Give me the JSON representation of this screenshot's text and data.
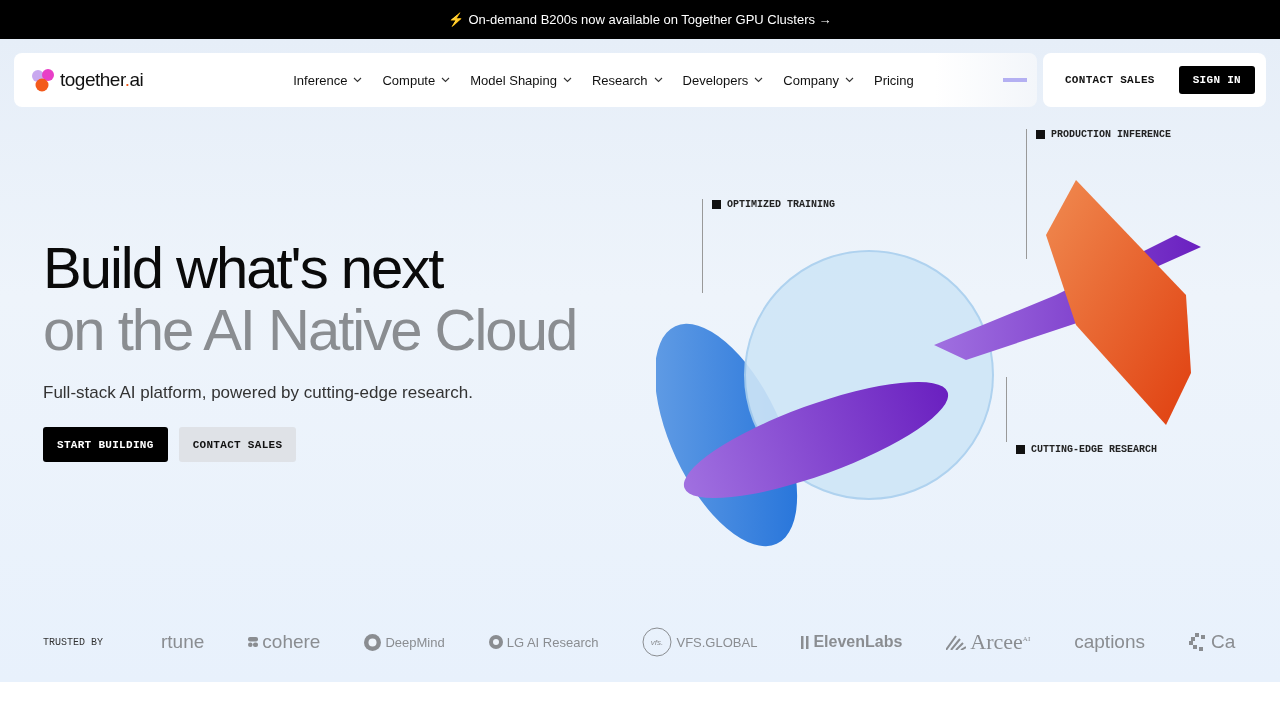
{
  "announcement": {
    "icon": "⚡",
    "text": "On-demand B200s now available on Together GPU Clusters →"
  },
  "nav": {
    "logo": {
      "name": "together",
      "accent": ".",
      "suffix": "ai"
    },
    "items": [
      {
        "label": "Inference",
        "dropdown": true
      },
      {
        "label": "Compute",
        "dropdown": true
      },
      {
        "label": "Model Shaping",
        "dropdown": true
      },
      {
        "label": "Research",
        "dropdown": true
      },
      {
        "label": "Developers",
        "dropdown": true
      },
      {
        "label": "Company",
        "dropdown": true
      },
      {
        "label": "Pricing",
        "dropdown": false
      }
    ],
    "contact": "CONTACT SALES",
    "sign_in": "SIGN IN"
  },
  "hero": {
    "title": "Build what's next",
    "title_2": "on the AI Native Cloud",
    "subtitle": "Full-stack AI platform, powered by cutting-edge research.",
    "primary": "START BUILDING",
    "secondary": "CONTACT SALES",
    "callouts": [
      {
        "label": "OPTIMIZED TRAINING"
      },
      {
        "label": "PRODUCTION INFERENCE"
      },
      {
        "label": "CUTTING-EDGE RESEARCH"
      }
    ]
  },
  "trusted": {
    "label": "TRUSTED BY",
    "logos": [
      {
        "text": "rtune",
        "kind": "plain"
      },
      {
        "text": "cohere",
        "kind": "cohere"
      },
      {
        "text": "DeepMind",
        "kind": "deepmind"
      },
      {
        "text": "LG AI Research",
        "kind": "lg"
      },
      {
        "text": "VFS.GLOBAL",
        "kind": "vfs",
        "icon_text": "vfs."
      },
      {
        "text": "ElevenLabs",
        "kind": "eleven"
      },
      {
        "text": "Arcee",
        "kind": "arcee",
        "superscript": "AI"
      },
      {
        "text": "captions",
        "kind": "plain"
      },
      {
        "text": "Ca",
        "kind": "pixel"
      }
    ]
  }
}
